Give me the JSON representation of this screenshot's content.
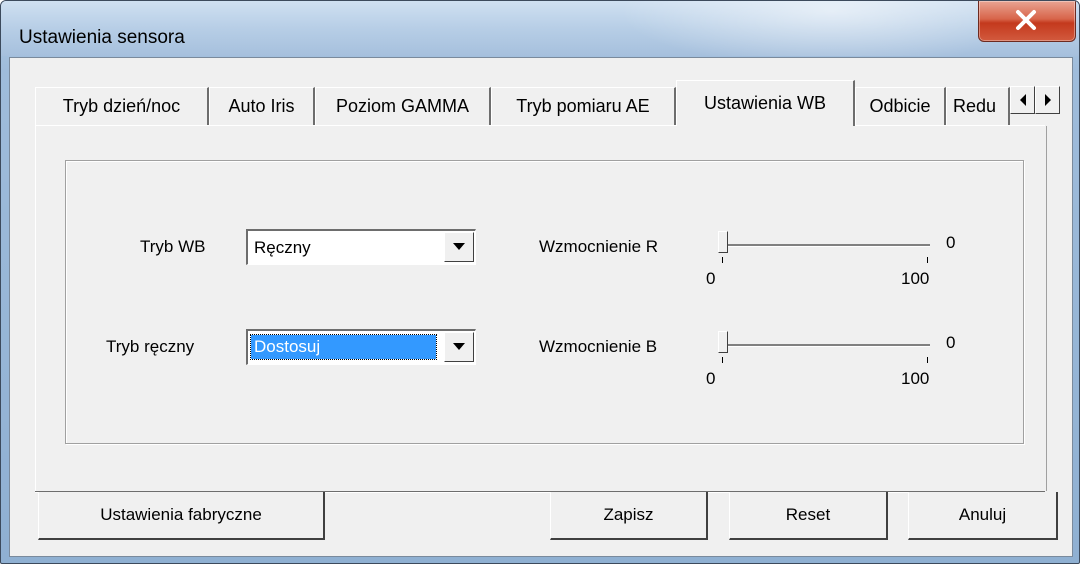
{
  "window": {
    "title": "Ustawienia sensora",
    "close_icon": "close-x-icon"
  },
  "tabs": [
    {
      "label": "Tryb dzień/noc",
      "active": false
    },
    {
      "label": "Auto Iris",
      "active": false
    },
    {
      "label": "Poziom GAMMA",
      "active": false
    },
    {
      "label": "Tryb pomiaru AE",
      "active": false
    },
    {
      "label": "Ustawienia WB",
      "active": true
    },
    {
      "label": "Odbicie",
      "active": false
    },
    {
      "label": "Redu",
      "active": false
    }
  ],
  "tab_scroll": {
    "left_icon": "arrow-left-icon",
    "right_icon": "arrow-right-icon"
  },
  "wb": {
    "mode_label": "Tryb WB",
    "mode_value": "Ręczny",
    "manual_label": "Tryb ręczny",
    "manual_value": "Dostosuj",
    "gain_r": {
      "label": "Wzmocnienie R",
      "value": "0",
      "min": "0",
      "max": "100"
    },
    "gain_b": {
      "label": "Wzmocnienie B",
      "value": "0",
      "min": "0",
      "max": "100"
    }
  },
  "buttons": {
    "factory": "Ustawienia fabryczne",
    "save": "Zapisz",
    "reset": "Reset",
    "cancel": "Anuluj"
  },
  "colors": {
    "selection": "#3399ff",
    "close_button": "#c4391d"
  }
}
